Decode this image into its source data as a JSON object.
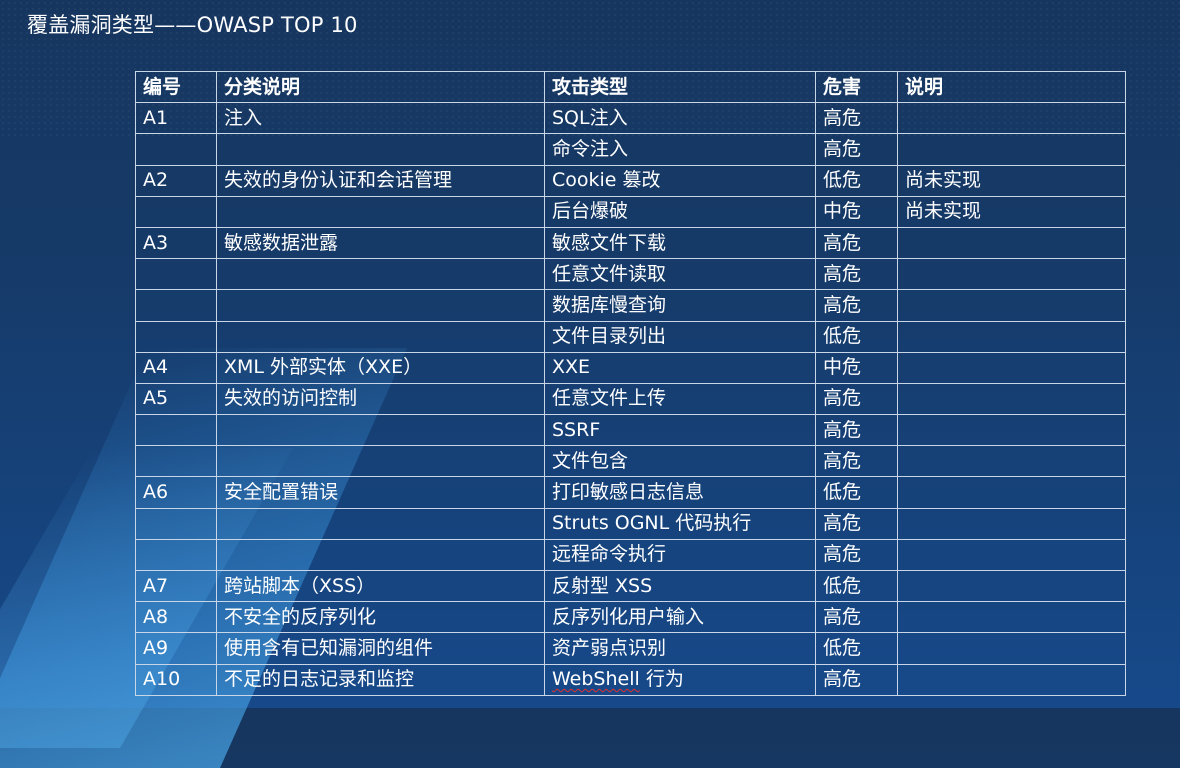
{
  "title": "覆盖漏洞类型——OWASP TOP 10",
  "table": {
    "headers": [
      "编号",
      "分类说明",
      "攻击类型",
      "危害",
      "说明"
    ],
    "rows": [
      [
        "A1",
        "注入",
        "SQL注入",
        "高危",
        ""
      ],
      [
        "",
        "",
        "命令注入",
        "高危",
        ""
      ],
      [
        "A2",
        "失效的身份认证和会话管理",
        "Cookie 篡改",
        "低危",
        "尚未实现"
      ],
      [
        "",
        "",
        "后台爆破",
        "中危",
        "尚未实现"
      ],
      [
        "A3",
        "敏感数据泄露",
        "敏感文件下载",
        "高危",
        ""
      ],
      [
        "",
        "",
        "任意文件读取",
        "高危",
        ""
      ],
      [
        "",
        "",
        "数据库慢查询",
        "高危",
        ""
      ],
      [
        "",
        "",
        "文件目录列出",
        "低危",
        ""
      ],
      [
        "A4",
        "XML 外部实体（XXE）",
        "XXE",
        "中危",
        ""
      ],
      [
        "A5",
        "失效的访问控制",
        "任意文件上传",
        "高危",
        ""
      ],
      [
        "",
        "",
        "SSRF",
        "高危",
        ""
      ],
      [
        "",
        "",
        "文件包含",
        "高危",
        ""
      ],
      [
        "A6",
        "安全配置错误",
        "打印敏感日志信息",
        "低危",
        ""
      ],
      [
        "",
        "",
        "Struts OGNL 代码执行",
        "高危",
        ""
      ],
      [
        "",
        "",
        "远程命令执行",
        "高危",
        ""
      ],
      [
        "A7",
        "跨站脚本（XSS）",
        "反射型 XSS",
        "低危",
        ""
      ],
      [
        "A8",
        "不安全的反序列化",
        "反序列化用户输入",
        "高危",
        ""
      ],
      [
        "A9",
        "使用含有已知漏洞的组件",
        "资产弱点识别",
        "低危",
        ""
      ],
      [
        "A10",
        "不足的日志记录和监控",
        "WebShell 行为",
        "高危",
        ""
      ]
    ]
  },
  "colors": {
    "background_top": "#16365f",
    "background_bottom": "#17498a",
    "text": "#ffffff",
    "grid_line": "#c9d6e8"
  }
}
